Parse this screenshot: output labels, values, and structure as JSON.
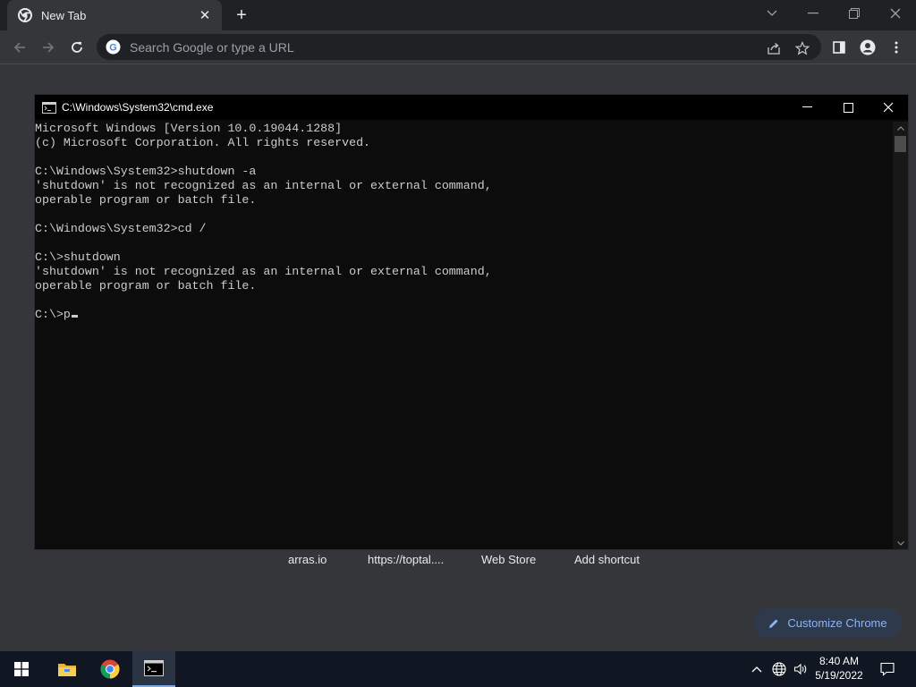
{
  "browser": {
    "tab": {
      "title": "New Tab"
    },
    "omnibox": {
      "placeholder": "Search Google or type a URL"
    },
    "shortcuts": [
      {
        "label": "arras.io"
      },
      {
        "label": "https://toptal...."
      },
      {
        "label": "Web Store"
      },
      {
        "label": "Add shortcut"
      }
    ],
    "customize_label": "Customize Chrome"
  },
  "cmd": {
    "title": "C:\\Windows\\System32\\cmd.exe",
    "lines": [
      "Microsoft Windows [Version 10.0.19044.1288]",
      "(c) Microsoft Corporation. All rights reserved.",
      "",
      "C:\\Windows\\System32>shutdown -a",
      "'shutdown' is not recognized as an internal or external command,",
      "operable program or batch file.",
      "",
      "C:\\Windows\\System32>cd /",
      "",
      "C:\\>shutdown",
      "'shutdown' is not recognized as an internal or external command,",
      "operable program or batch file.",
      ""
    ],
    "prompt_line": "C:\\>p"
  },
  "taskbar": {
    "time": "8:40 AM",
    "date": "5/19/2022"
  },
  "colors": {
    "chrome_dark": "#202124",
    "chrome_toolbar": "#35363a",
    "cmd_bg": "#0c0c0c",
    "cmd_text": "#cccccc",
    "accent_blue": "#8ab4f8",
    "taskbar_bg": "#101722"
  }
}
